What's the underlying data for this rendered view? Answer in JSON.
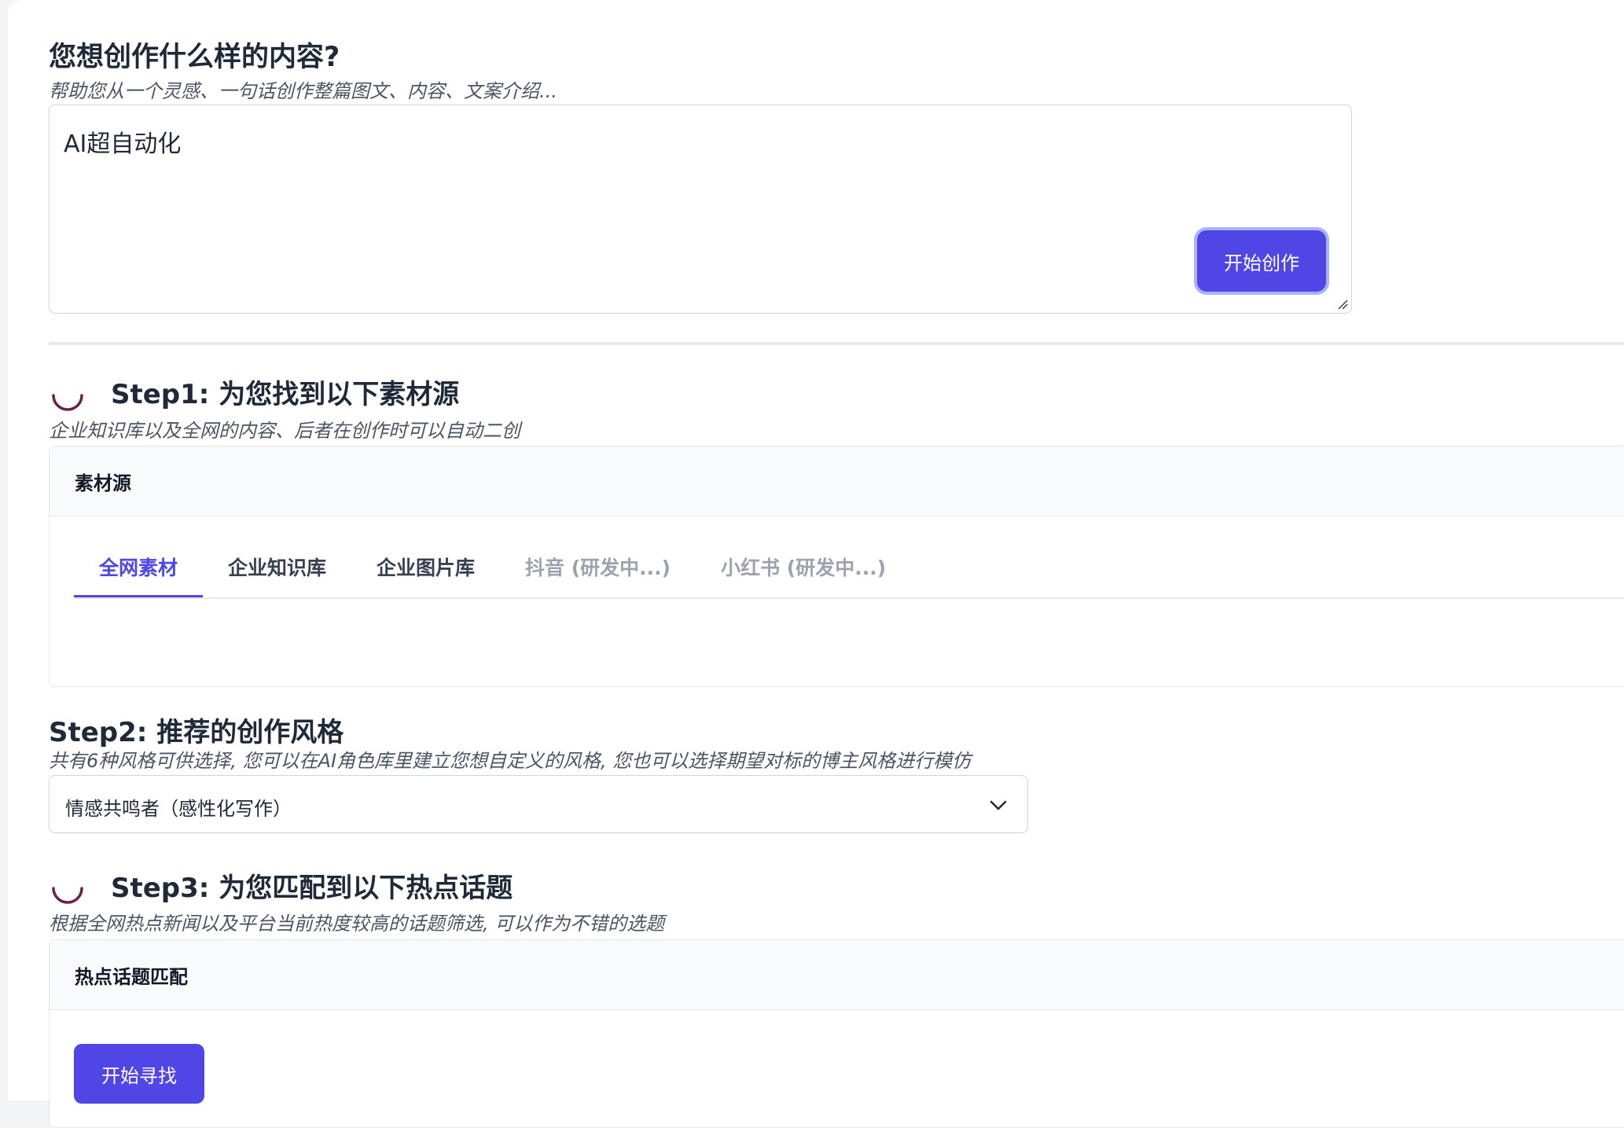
{
  "prompt": {
    "title": "您想创作什么样的内容?",
    "subtitle": "帮助您从一个灵感、一句话创作整篇图文、内容、文案介绍...",
    "input_value": "AI超自动化",
    "start_button": "开始创作"
  },
  "step1": {
    "title": "Step1: 为您找到以下素材源",
    "subtitle": "企业知识库以及全网的内容、后者在创作时可以自动二创",
    "card_title": "素材源",
    "tabs": [
      {
        "label": "全网素材"
      },
      {
        "label": "企业知识库"
      },
      {
        "label": "企业图片库"
      },
      {
        "label": "抖音 (研发中...)"
      },
      {
        "label": "小红书 (研发中...)"
      }
    ]
  },
  "step2": {
    "title": "Step2: 推荐的创作风格",
    "subtitle": "共有6种风格可供选择, 您可以在AI角色库里建立您想自定义的风格, 您也可以选择期望对标的博主风格进行模仿",
    "selected_style": "情感共鸣者（感性化写作）"
  },
  "step3": {
    "title": "Step3: 为您匹配到以下热点话题",
    "subtitle": "根据全网热点新闻以及平台当前热度较高的话题筛选, 可以作为不错的选题",
    "card_title": "热点话题匹配",
    "find_button": "开始寻找"
  },
  "colors": {
    "accent": "#4f46e5",
    "spinner": "#6b2150"
  },
  "icons": {
    "spinner": "loading-spinner-icon",
    "chevron": "chevron-down-icon",
    "resize": "resize-handle-icon"
  }
}
